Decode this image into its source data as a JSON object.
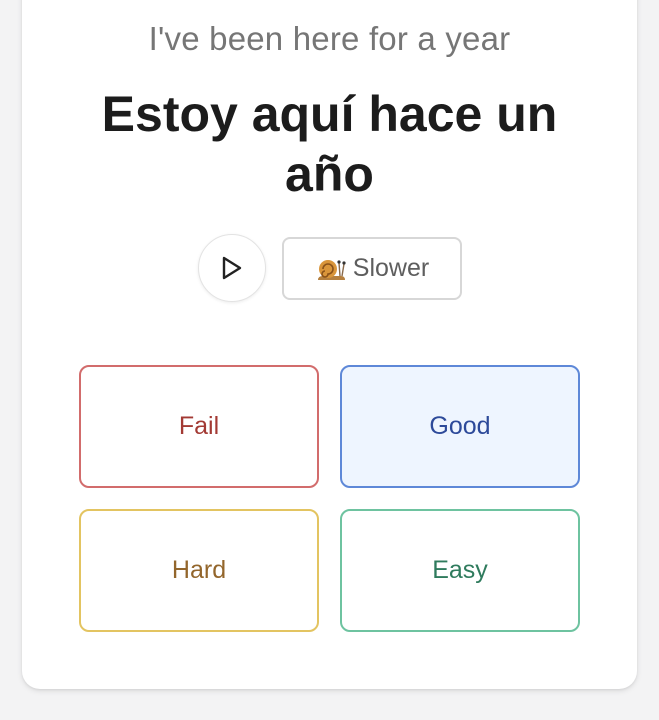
{
  "card": {
    "prompt": "I've been here for a year",
    "answer": "Estoy aquí hace un año"
  },
  "audio": {
    "play_icon": "play-icon",
    "slower_icon": "snail-icon",
    "slower_label": "Slower"
  },
  "grades": {
    "fail": {
      "label": "Fail",
      "color": "#a33a34",
      "border": "#d26c6c"
    },
    "good": {
      "label": "Good",
      "color": "#2d4a9a",
      "border": "#5e88d8",
      "background": "#eef5ff"
    },
    "hard": {
      "label": "Hard",
      "color": "#93662c",
      "border": "#e3c461"
    },
    "easy": {
      "label": "Easy",
      "color": "#2f7b5d",
      "border": "#6ec3a0"
    }
  }
}
